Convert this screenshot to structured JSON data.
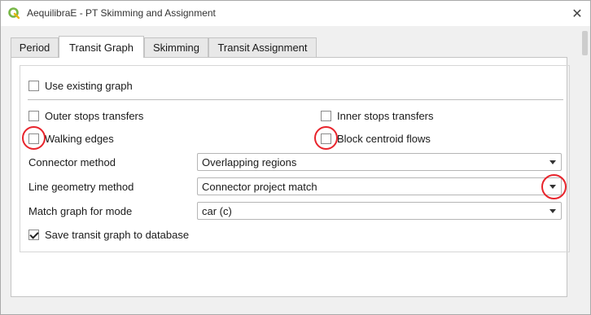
{
  "window": {
    "title": "AequilibraE - PT Skimming and Assignment",
    "close_glyph": "✕"
  },
  "tabs": [
    {
      "label": "Period",
      "active": false
    },
    {
      "label": "Transit Graph",
      "active": true
    },
    {
      "label": "Skimming",
      "active": false
    },
    {
      "label": "Transit Assignment",
      "active": false
    }
  ],
  "graph": {
    "use_existing_graph": {
      "label": "Use existing graph",
      "checked": false
    },
    "outer_stops_transfers": {
      "label": "Outer stops transfers",
      "checked": false
    },
    "inner_stops_transfers": {
      "label": "Inner stops transfers",
      "checked": false
    },
    "walking_edges": {
      "label": "Walking edges",
      "checked": false
    },
    "block_centroid_flows": {
      "label": "Block centroid flows",
      "checked": false
    },
    "connector_method": {
      "label": "Connector method",
      "value": "Overlapping regions"
    },
    "line_geometry_method": {
      "label": "Line geometry method",
      "value": "Connector project match"
    },
    "match_graph_for_mode": {
      "label": "Match graph for mode",
      "value": "car (c)"
    },
    "save_transit_graph": {
      "label": "Save transit graph to database",
      "checked": true
    }
  },
  "colors": {
    "highlight": "#e8242c",
    "qgis_logo": "#77b747"
  }
}
